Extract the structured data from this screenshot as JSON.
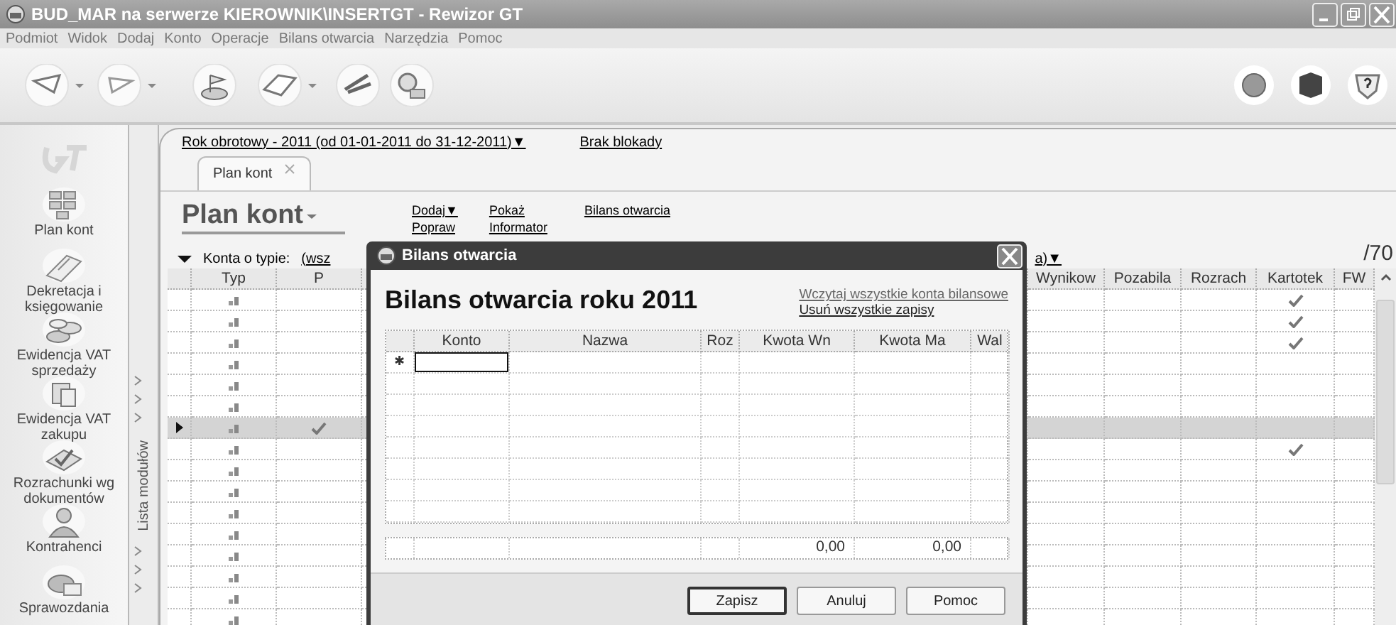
{
  "window": {
    "title": "BUD_MAR na serwerze KIEROWNIK\\INSERTGT - Rewizor GT"
  },
  "menu": [
    "Podmiot",
    "Widok",
    "Dodaj",
    "Konto",
    "Operacje",
    "Bilans otwarcia",
    "Narzędzia",
    "Pomoc"
  ],
  "sidebar": {
    "modules": [
      {
        "label": "Plan kont"
      },
      {
        "label": "Dekretacja i księgowanie"
      },
      {
        "label": "Ewidencja VAT sprzedaży"
      },
      {
        "label": "Ewidencja VAT zakupu"
      },
      {
        "label": "Rozrachunki wg dokumentów"
      },
      {
        "label": "Kontrahenci"
      },
      {
        "label": "Sprawozdania"
      }
    ],
    "strip_label": "Lista modułów"
  },
  "fiscal_year": "Rok obrotowy - 2011  (od 01-01-2011 do 31-12-2011)▼",
  "lock": "Brak blokady",
  "tabs": [
    {
      "label": "Plan kont",
      "selected": true
    }
  ],
  "page_title": "Plan kont",
  "actions": [
    [
      "Dodaj▼",
      "Popraw"
    ],
    [
      "Pokaż",
      "Informator"
    ],
    [
      "Bilans otwarcia"
    ]
  ],
  "filter": {
    "label": "Konta o typie:",
    "value_start": "(wsz",
    "value_end": "a)▼"
  },
  "counter": "/70",
  "grid": {
    "columns_left": [
      "Typ",
      "P"
    ],
    "columns_right": [
      "Wynikow",
      "Pozabila",
      "Rozrach",
      "Kartotek",
      "FW"
    ],
    "rows": [
      {
        "selected": false,
        "p": false,
        "kartotek": true
      },
      {
        "selected": false,
        "p": false,
        "kartotek": true
      },
      {
        "selected": false,
        "p": false,
        "kartotek": true
      },
      {
        "selected": false,
        "p": false,
        "kartotek": false
      },
      {
        "selected": false,
        "p": false,
        "kartotek": false
      },
      {
        "selected": false,
        "p": false,
        "kartotek": false
      },
      {
        "selected": true,
        "p": true,
        "kartotek": false
      },
      {
        "selected": false,
        "p": false,
        "kartotek": true
      },
      {
        "selected": false,
        "p": false,
        "kartotek": false
      },
      {
        "selected": false,
        "p": false,
        "kartotek": false
      },
      {
        "selected": false,
        "p": false,
        "kartotek": false
      },
      {
        "selected": false,
        "p": false,
        "kartotek": false
      },
      {
        "selected": false,
        "p": false,
        "kartotek": false
      },
      {
        "selected": false,
        "p": false,
        "kartotek": false
      },
      {
        "selected": false,
        "p": false,
        "kartotek": false
      },
      {
        "selected": false,
        "p": false,
        "kartotek": false
      }
    ]
  },
  "dialog": {
    "title": "Bilans otwarcia",
    "heading": "Bilans otwarcia roku 2011",
    "links": [
      "Wczytaj wszystkie konta bilansowe",
      "Usuń wszystkie zapisy"
    ],
    "columns": [
      "Konto",
      "Nazwa",
      "Roz",
      "Kwota Wn",
      "Kwota Ma",
      "Wal"
    ],
    "new_row_marker": "✱",
    "totals": {
      "kwota_wn": "0,00",
      "kwota_ma": "0,00"
    },
    "buttons": [
      {
        "label": "Zapisz",
        "default": true
      },
      {
        "label": "Anuluj",
        "default": false
      },
      {
        "label": "Pomoc",
        "default": false
      }
    ]
  }
}
